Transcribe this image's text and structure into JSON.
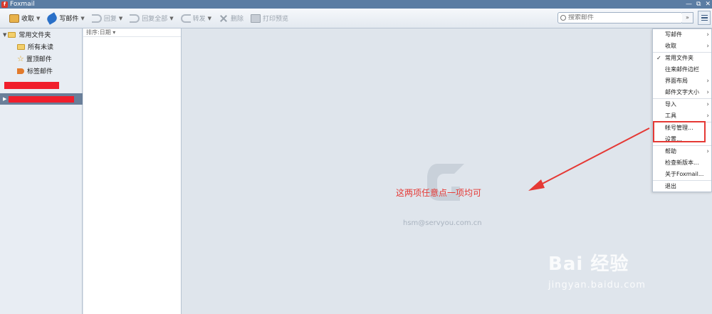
{
  "window": {
    "title": "Foxmail",
    "controls": [
      "—",
      "⧉",
      "✕"
    ]
  },
  "toolbar": {
    "receive": "收取",
    "write": "写邮件",
    "reply": "回复",
    "reply_all": "回复全部",
    "forward": "转发",
    "delete": "删除",
    "print_preview": "打印预览"
  },
  "search": {
    "placeholder": "搜索邮件"
  },
  "sidebar": {
    "root": "常用文件夹",
    "items": [
      {
        "label": "所有未读",
        "icon": "folder-icon"
      },
      {
        "label": "置顶邮件",
        "icon": "star-icon"
      },
      {
        "label": "标签邮件",
        "icon": "tag-icon"
      }
    ]
  },
  "mail_list": {
    "sort_label": "排序:日期"
  },
  "main": {
    "email": "hsm@servyou.com.cn",
    "annotation": "这两项任意点一项均可"
  },
  "menu": {
    "items": [
      {
        "label": "写邮件",
        "submenu": true
      },
      {
        "label": "收取",
        "submenu": true
      },
      {
        "sep": true
      },
      {
        "label": "常用文件夹",
        "checked": true
      },
      {
        "label": "往来邮件边栏"
      },
      {
        "label": "界面布局",
        "submenu": true
      },
      {
        "label": "邮件文字大小",
        "submenu": true
      },
      {
        "sep": true
      },
      {
        "label": "导入",
        "submenu": true
      },
      {
        "label": "工具",
        "submenu": true
      },
      {
        "sep": true
      },
      {
        "label": "帐号管理..."
      },
      {
        "label": "设置..."
      },
      {
        "sep": true
      },
      {
        "label": "帮助",
        "submenu": true
      },
      {
        "label": "检查新版本..."
      },
      {
        "label": "关于Foxmail..."
      },
      {
        "sep": true
      },
      {
        "label": "退出"
      }
    ]
  },
  "watermark": {
    "brand": "Bai 经验",
    "domain": "jingyan.baidu.com"
  },
  "colors": {
    "accent": "#5b7da3",
    "annotation": "#e53935",
    "redaction": "#f01e2c"
  }
}
